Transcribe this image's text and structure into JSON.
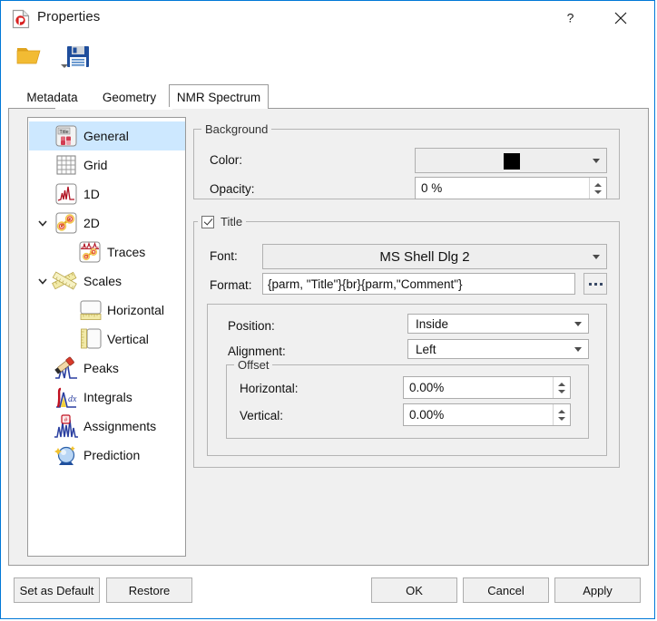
{
  "window": {
    "title": "Properties",
    "app_icon": "document-red-circle-icon",
    "help_label": "?",
    "close_label": "×"
  },
  "toolbar": {
    "open_label": "Open",
    "open_icon": "open-folder-icon",
    "open_dropdown_icon": "chevron-down-icon",
    "save_label": "Save",
    "save_icon": "floppy-disk-icon"
  },
  "tabs": [
    {
      "label": "Metadata",
      "selected": false
    },
    {
      "label": "Geometry",
      "selected": false
    },
    {
      "label": "NMR Spectrum",
      "selected": true
    }
  ],
  "tree": {
    "items": [
      {
        "label": "General",
        "icon": "title-general-icon",
        "selected": true,
        "indent": 0,
        "expander": ""
      },
      {
        "label": "Grid",
        "icon": "grid-icon",
        "selected": false,
        "indent": 0,
        "expander": ""
      },
      {
        "label": "1D",
        "icon": "spectrum-1d-icon",
        "selected": false,
        "indent": 0,
        "expander": ""
      },
      {
        "label": "2D",
        "icon": "spectrum-2d-icon",
        "selected": false,
        "indent": 0,
        "expander": "expanded"
      },
      {
        "label": "Traces",
        "icon": "traces-icon",
        "selected": false,
        "indent": 1,
        "expander": ""
      },
      {
        "label": "Scales",
        "icon": "rulers-icon",
        "selected": false,
        "indent": 0,
        "expander": "expanded"
      },
      {
        "label": "Horizontal",
        "icon": "horizontal-ruler-icon",
        "selected": false,
        "indent": 1,
        "expander": ""
      },
      {
        "label": "Vertical",
        "icon": "vertical-ruler-icon",
        "selected": false,
        "indent": 1,
        "expander": ""
      },
      {
        "label": "Peaks",
        "icon": "peaks-picker-icon",
        "selected": false,
        "indent": 0,
        "expander": ""
      },
      {
        "label": "Integrals",
        "icon": "integrals-icon",
        "selected": false,
        "indent": 0,
        "expander": ""
      },
      {
        "label": "Assignments",
        "icon": "assignments-icon",
        "selected": false,
        "indent": 0,
        "expander": ""
      },
      {
        "label": "Prediction",
        "icon": "prediction-orb-icon",
        "selected": false,
        "indent": 0,
        "expander": ""
      }
    ]
  },
  "background_group": {
    "title": "Background",
    "color_label": "Color:",
    "color_value": "#000000",
    "opacity_label": "Opacity:",
    "opacity_value": "0 %"
  },
  "title_group": {
    "title": "Title",
    "checked": true,
    "font_label": "Font:",
    "font_value": "MS Shell Dlg 2",
    "format_label": "Format:",
    "format_value": "{parm, \"Title\"}{br}{parm,\"Comment\"}",
    "format_browse_label": "...",
    "position_label": "Position:",
    "position_value": "Inside",
    "alignment_label": "Alignment:",
    "alignment_value": "Left",
    "offset": {
      "title": "Offset",
      "horizontal_label": "Horizontal:",
      "horizontal_value": "0.00%",
      "vertical_label": "Vertical:",
      "vertical_value": "0.00%"
    }
  },
  "footer": {
    "set_as_default": "Set as Default",
    "restore": "Restore",
    "ok": "OK",
    "cancel": "Cancel",
    "apply": "Apply"
  },
  "colors": {
    "accent": "#0078d7",
    "selection": "#cde8ff",
    "panel": "#f0f0f0"
  }
}
